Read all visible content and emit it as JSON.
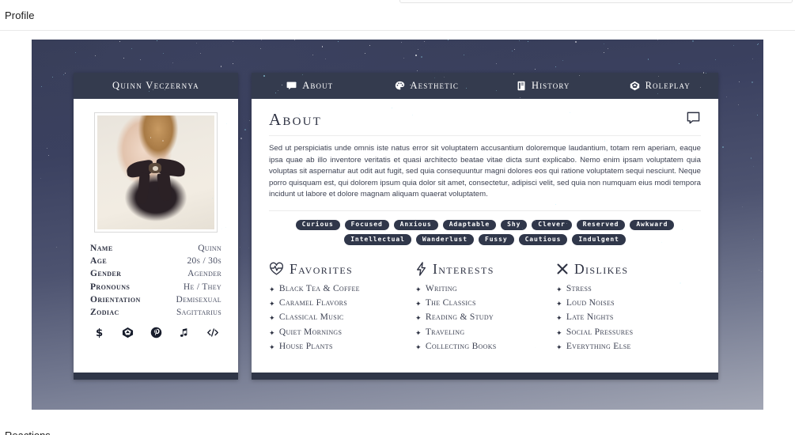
{
  "page": {
    "profile_label": "Profile",
    "bottom_cut_text": "Reactions"
  },
  "colors": {
    "panel_header": "#343b4e",
    "panel_footer": "#2f3648",
    "tag_bg": "#30374a",
    "text_dark": "#2d3142",
    "body_text": "#3c4152",
    "card_bg": "#ffffff",
    "starfield_top": "#363c55",
    "starfield_bottom": "#a3a7b5"
  },
  "left_panel": {
    "name": "Quinn Veczernya",
    "avatar_alt": "portrait-photo",
    "stats": [
      {
        "label": "Name",
        "value": "Quinn"
      },
      {
        "label": "Age",
        "value": "20s / 30s"
      },
      {
        "label": "Gender",
        "value": "Agender"
      },
      {
        "label": "Pronouns",
        "value": "He / They"
      },
      {
        "label": "Orientation",
        "value": "Demisexual"
      },
      {
        "label": "Zodiac",
        "value": "Sagittarius"
      }
    ],
    "socials": [
      {
        "icon": "dollar-icon",
        "glyph": "$"
      },
      {
        "icon": "d20-dice-icon",
        "glyph": "d20"
      },
      {
        "icon": "pinterest-icon",
        "glyph": "P"
      },
      {
        "icon": "music-note-icon",
        "glyph": "♫"
      },
      {
        "icon": "code-icon",
        "glyph": "</>"
      }
    ]
  },
  "right_panel": {
    "tabs": [
      {
        "label": "About",
        "icon": "comment-icon",
        "active": true
      },
      {
        "label": "Aesthetic",
        "icon": "palette-icon",
        "active": false
      },
      {
        "label": "History",
        "icon": "book-icon",
        "active": false
      },
      {
        "label": "Roleplay",
        "icon": "d20-dice-icon",
        "active": false
      }
    ],
    "about": {
      "title": "About",
      "corner_icon": "speech-bubble-icon",
      "body": "Sed ut perspiciatis unde omnis iste natus error sit voluptatem accusantium doloremque laudantium, totam rem aperiam, eaque ipsa quae ab illo inventore veritatis et quasi architecto beatae vitae dicta sunt explicabo. Nemo enim ipsam voluptatem quia voluptas sit aspernatur aut odit aut fugit, sed quia consequuntur magni dolores eos qui ratione voluptatem sequi nesciunt. Neque porro quisquam est, qui dolorem ipsum quia dolor sit amet, consectetur, adipisci velit, sed quia non numquam eius modi tempora incidunt ut labore et dolore magnam aliquam quaerat voluptatem."
    },
    "tags": [
      "Curious",
      "Focused",
      "Anxious",
      "Adaptable",
      "Shy",
      "Clever",
      "Reserved",
      "Awkward",
      "Intellectual",
      "Wanderlust",
      "Fussy",
      "Cautious",
      "Indulgent"
    ],
    "columns": [
      {
        "title": "Favorites",
        "icon": "heart-pulse-icon",
        "items": [
          "Black Tea & Coffee",
          "Caramel Flavors",
          "Classical Music",
          "Quiet Mornings",
          "House Plants"
        ]
      },
      {
        "title": "Interests",
        "icon": "lightning-bolt-icon",
        "items": [
          "Writing",
          "The Classics",
          "Reading & Study",
          "Traveling",
          "Collecting Books"
        ]
      },
      {
        "title": "Dislikes",
        "icon": "x-mark-icon",
        "items": [
          "Stress",
          "Loud Noises",
          "Late Nights",
          "Social Pressures",
          "Everything Else"
        ]
      }
    ]
  }
}
